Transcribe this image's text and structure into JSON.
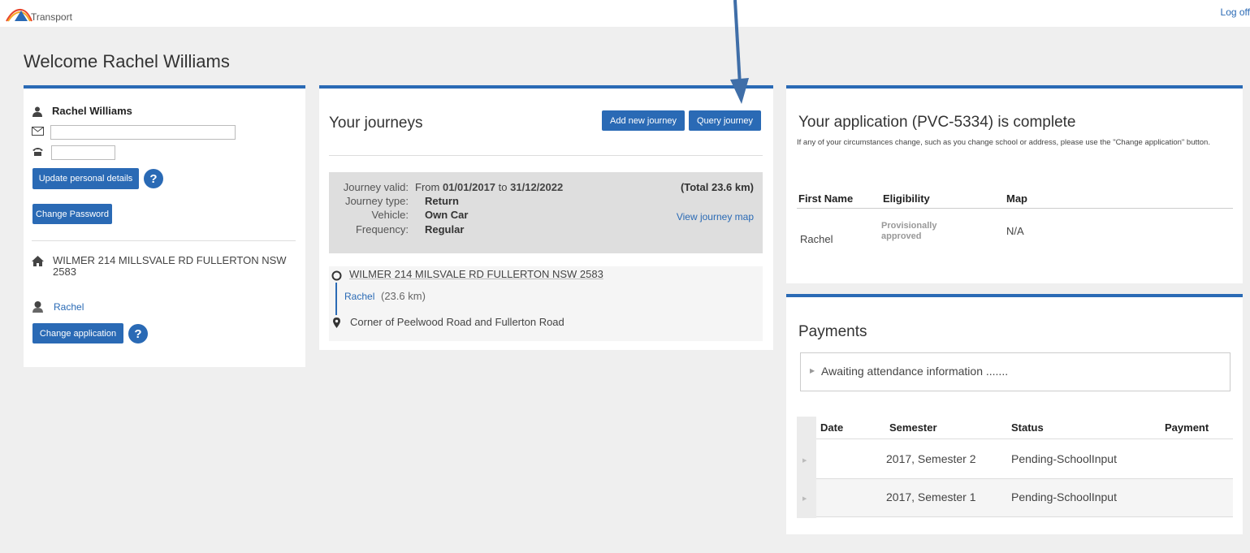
{
  "header": {
    "brand": "Transport",
    "logoff": "Log off"
  },
  "welcome": "Welcome Rachel Williams",
  "profile": {
    "name": "Rachel Williams",
    "email_value": "",
    "phone_value": "",
    "update_button": "Update personal details",
    "help": "?",
    "password_button": "Change Password",
    "address": "WILMER 214 MILLSVALE RD FULLERTON NSW 2583",
    "student": "Rachel",
    "change_application_button": "Change application"
  },
  "journeys": {
    "title": "Your journeys",
    "add_button": "Add new journey",
    "query_button": "Query journey",
    "valid_label": "Journey valid:",
    "valid_from_word": "From",
    "valid_from": "01/01/2017",
    "valid_to_word": "to",
    "valid_to": "31/12/2022",
    "total": "(Total 23.6 km)",
    "type_label": "Journey type:",
    "type_value": "Return",
    "vehicle_label": "Vehicle:",
    "vehicle_value": "Own Car",
    "frequency_label": "Frequency:",
    "frequency_value": "Regular",
    "map_link": "View journey map",
    "start": "WILMER 214 MILSVALE RD FULLERTON NSW 2583",
    "leg_student": "Rachel",
    "leg_distance": "(23.6 km)",
    "end": "Corner of Peelwood Road and Fullerton Road"
  },
  "application": {
    "title": "Your application (PVC-5334) is complete",
    "note": "If any of your circumstances change, such as you change school or address, please use the \"Change application\" button.",
    "columns": [
      "First Name",
      "Eligibility",
      "Map"
    ],
    "row": {
      "first_name": "Rachel",
      "eligibility": "Provisionally approved",
      "map": "N/A"
    }
  },
  "payments": {
    "title": "Payments",
    "awaiting": "Awaiting attendance information .......",
    "columns": [
      "Date",
      "Semester",
      "Status",
      "Payment"
    ],
    "rows": [
      {
        "date": "",
        "semester": "2017, Semester 2",
        "status": "Pending-SchoolInput",
        "payment": ""
      },
      {
        "date": "",
        "semester": "2017, Semester 1",
        "status": "Pending-SchoolInput",
        "payment": ""
      }
    ]
  },
  "colors": {
    "accent": "#2a6ab5",
    "background": "#efefef",
    "journey_box": "#dedede"
  }
}
